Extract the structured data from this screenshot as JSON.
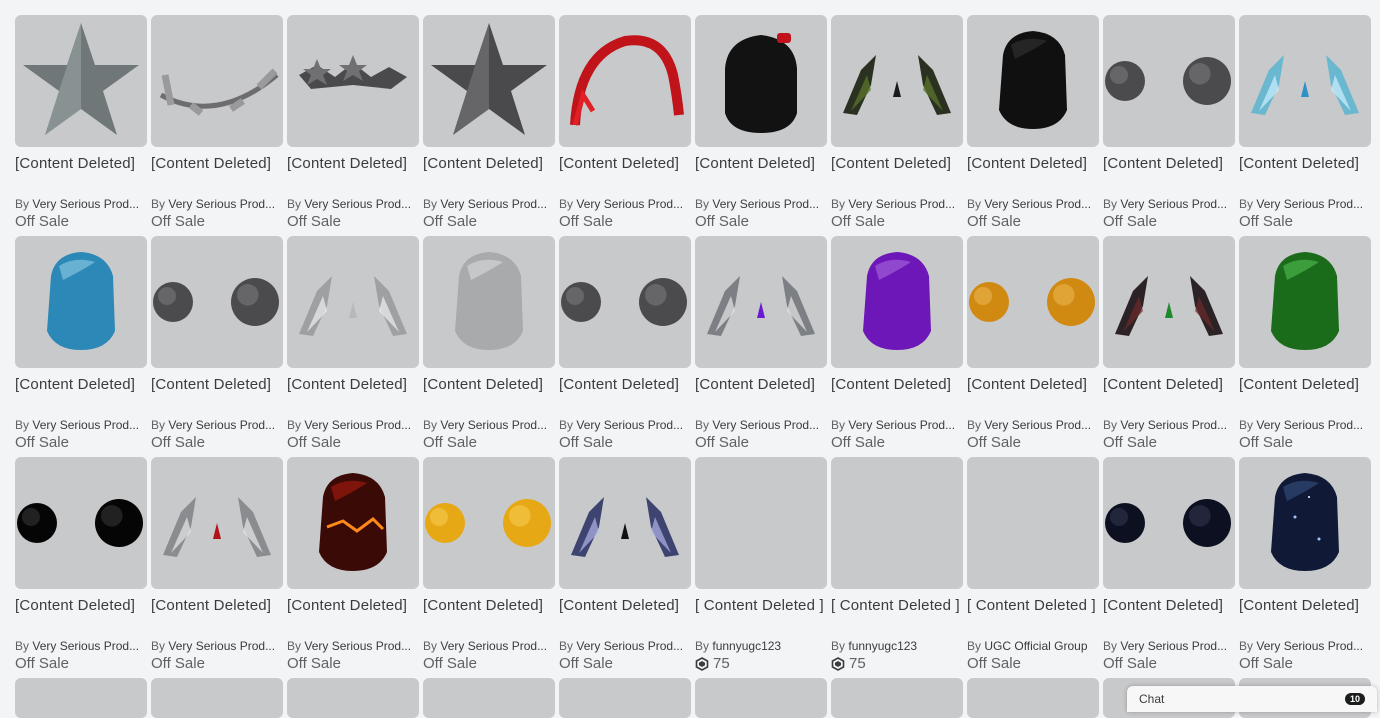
{
  "items": [
    {
      "name": "[Content Deleted]",
      "by": "By",
      "creator": "Very Serious Prod...",
      "price": "Off Sale",
      "icon": "star-silver",
      "robux": false
    },
    {
      "name": "[Content Deleted]",
      "by": "By",
      "creator": "Very Serious Prod...",
      "price": "Off Sale",
      "icon": "star-chain",
      "robux": false
    },
    {
      "name": "[Content Deleted]",
      "by": "By",
      "creator": "Very Serious Prod...",
      "price": "Off Sale",
      "icon": "star-crown",
      "robux": false
    },
    {
      "name": "[Content Deleted]",
      "by": "By",
      "creator": "Very Serious Prod...",
      "price": "Off Sale",
      "icon": "star-dark",
      "robux": false
    },
    {
      "name": "[Content Deleted]",
      "by": "By",
      "creator": "Very Serious Prod...",
      "price": "Off Sale",
      "icon": "red-braids",
      "robux": false
    },
    {
      "name": "[Content Deleted]",
      "by": "By",
      "creator": "Very Serious Prod...",
      "price": "Off Sale",
      "icon": "black-hood",
      "robux": false
    },
    {
      "name": "[Content Deleted]",
      "by": "By",
      "creator": "Very Serious Prod...",
      "price": "Off Sale",
      "icon": "green-wings",
      "robux": false
    },
    {
      "name": "[Content Deleted]",
      "by": "By",
      "creator": "Very Serious Prod...",
      "price": "Off Sale",
      "icon": "black-hair",
      "robux": false
    },
    {
      "name": "[Content Deleted]",
      "by": "By",
      "creator": "Very Serious Prod...",
      "price": "Off Sale",
      "icon": "gray-orbs",
      "robux": false
    },
    {
      "name": "[Content Deleted]",
      "by": "By",
      "creator": "Very Serious Prod...",
      "price": "Off Sale",
      "icon": "ice-wings",
      "robux": false
    },
    {
      "name": "[Content Deleted]",
      "by": "By",
      "creator": "Very Serious Prod...",
      "price": "Off Sale",
      "icon": "blue-hair",
      "robux": false
    },
    {
      "name": "[Content Deleted]",
      "by": "By",
      "creator": "Very Serious Prod...",
      "price": "Off Sale",
      "icon": "gray-orbs",
      "robux": false
    },
    {
      "name": "[Content Deleted]",
      "by": "By",
      "creator": "Very Serious Prod...",
      "price": "Off Sale",
      "icon": "silver-wings",
      "robux": false
    },
    {
      "name": "[Content Deleted]",
      "by": "By",
      "creator": "Very Serious Prod...",
      "price": "Off Sale",
      "icon": "white-hair",
      "robux": false
    },
    {
      "name": "[Content Deleted]",
      "by": "By",
      "creator": "Very Serious Prod...",
      "price": "Off Sale",
      "icon": "gray-orbs",
      "robux": false
    },
    {
      "name": "[Content Deleted]",
      "by": "By",
      "creator": "Very Serious Prod...",
      "price": "Off Sale",
      "icon": "purple-wings",
      "robux": false
    },
    {
      "name": "[Content Deleted]",
      "by": "By",
      "creator": "Very Serious Prod...",
      "price": "Off Sale",
      "icon": "purple-hair",
      "robux": false
    },
    {
      "name": "[Content Deleted]",
      "by": "By",
      "creator": "Very Serious Prod...",
      "price": "Off Sale",
      "icon": "orange-orbs",
      "robux": false
    },
    {
      "name": "[Content Deleted]",
      "by": "By",
      "creator": "Very Serious Prod...",
      "price": "Off Sale",
      "icon": "dark-green-wings",
      "robux": false
    },
    {
      "name": "[Content Deleted]",
      "by": "By",
      "creator": "Very Serious Prod...",
      "price": "Off Sale",
      "icon": "green-hair",
      "robux": false
    },
    {
      "name": "[Content Deleted]",
      "by": "By",
      "creator": "Very Serious Prod...",
      "price": "Off Sale",
      "icon": "black-orbs",
      "robux": false
    },
    {
      "name": "[Content Deleted]",
      "by": "By",
      "creator": "Very Serious Prod...",
      "price": "Off Sale",
      "icon": "red-wings",
      "robux": false
    },
    {
      "name": "[Content Deleted]",
      "by": "By",
      "creator": "Very Serious Prod...",
      "price": "Off Sale",
      "icon": "lava-hair",
      "robux": false
    },
    {
      "name": "[Content Deleted]",
      "by": "By",
      "creator": "Very Serious Prod...",
      "price": "Off Sale",
      "icon": "gold-orbs",
      "robux": false
    },
    {
      "name": "[Content Deleted]",
      "by": "By",
      "creator": "Very Serious Prod...",
      "price": "Off Sale",
      "icon": "night-wings",
      "robux": false
    },
    {
      "name": "[ Content Deleted ]",
      "by": "By",
      "creator": "funnyugc123",
      "price": "75",
      "icon": "empty",
      "robux": true
    },
    {
      "name": "[ Content Deleted ]",
      "by": "By",
      "creator": "funnyugc123",
      "price": "75",
      "icon": "empty",
      "robux": true
    },
    {
      "name": "[ Content Deleted ]",
      "by": "By",
      "creator": "UGC Official Group",
      "price": "Off Sale",
      "icon": "empty",
      "robux": false
    },
    {
      "name": "[Content Deleted]",
      "by": "By",
      "creator": "Very Serious Prod...",
      "price": "Off Sale",
      "icon": "navy-orbs",
      "robux": false
    },
    {
      "name": "[Content Deleted]",
      "by": "By",
      "creator": "Very Serious Prod...",
      "price": "Off Sale",
      "icon": "galaxy-hair",
      "robux": false
    }
  ],
  "chat": {
    "label": "Chat",
    "badge": "10"
  },
  "colors": {
    "thumb_bg": "#c8c9cb",
    "page_bg": "#f2f4f5"
  }
}
